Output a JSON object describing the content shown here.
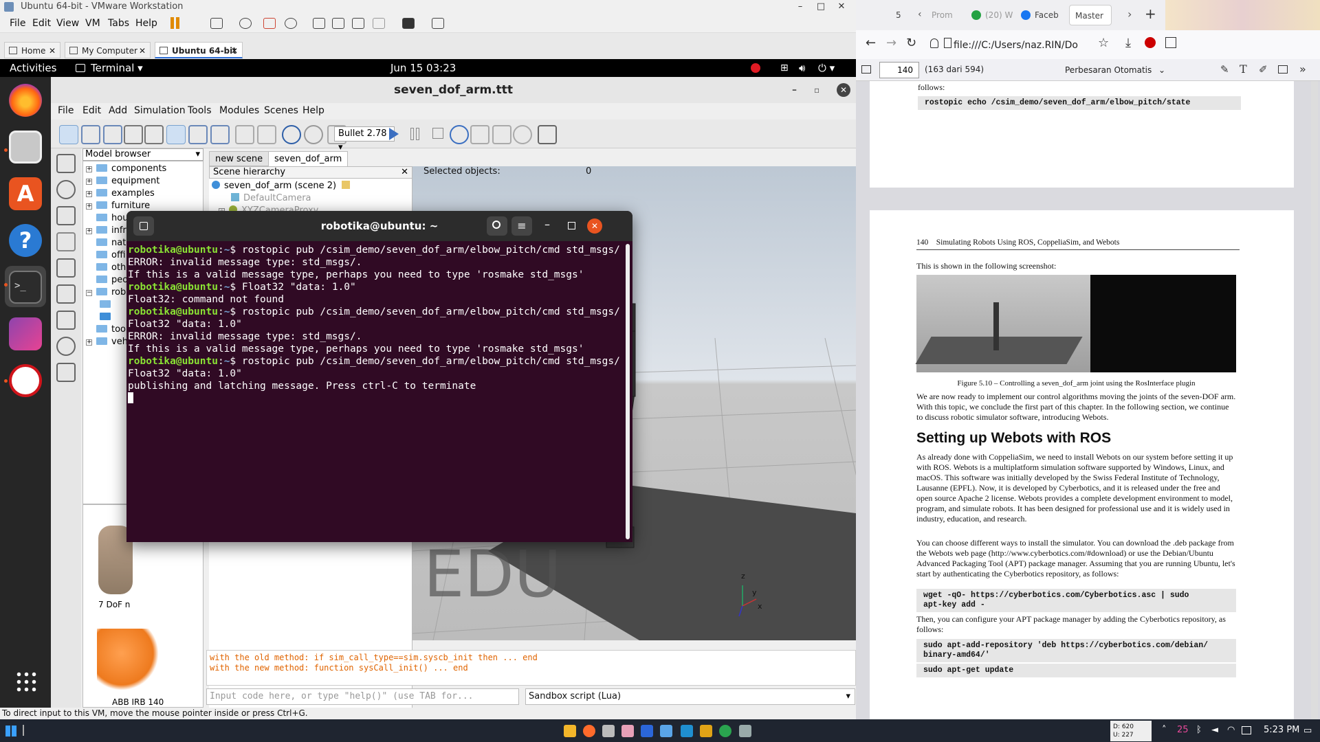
{
  "vmware": {
    "title": "Ubuntu 64-bit - VMware Workstation",
    "menu": [
      "File",
      "Edit",
      "View",
      "VM",
      "Tabs",
      "Help"
    ],
    "tabs": [
      {
        "label": "Home"
      },
      {
        "label": "My Computer"
      },
      {
        "label": "Ubuntu 64-bit"
      }
    ],
    "status_hint": "To direct input to this VM, move the mouse pointer inside or press Ctrl+G."
  },
  "ubuntu": {
    "activities": "Activities",
    "app_menu": "Terminal ▾",
    "clock": "Jun 15  03:23"
  },
  "coppelia": {
    "window_title": "seven_dof_arm.ttt",
    "menu": [
      "File",
      "Edit",
      "Add",
      "Simulation",
      "Tools",
      "Modules",
      "Scenes",
      "Help"
    ],
    "physics_engine": "Bullet 2.78",
    "model_browser": {
      "header": "Model browser",
      "items": [
        "components",
        "equipment",
        "examples",
        "furniture",
        "hou",
        "infr",
        "natu",
        "offi",
        "oth",
        "peo",
        "rob",
        "",
        "too",
        "veh"
      ],
      "thumbs": [
        {
          "label": "7 DoF n"
        },
        {
          "label": "ABB IRB 140"
        }
      ]
    },
    "scene_tabs": [
      "new scene",
      "seven_dof_arm"
    ],
    "scene_hierarchy": {
      "header": "Scene hierarchy",
      "items": [
        "seven_dof_arm (scene 2)",
        "DefaultCamera",
        "XYZCameraProxy"
      ]
    },
    "selected_objects_label": "Selected objects:",
    "selected_objects_count": "0",
    "watermark": "EDU",
    "console_lines": [
      "with the old method: if sim_call_type==sim.syscb_init then ... end",
      "with the new method: function sysCall_init() ... end"
    ],
    "input_placeholder": "Input code here, or type \"help()\" (use TAB for...",
    "script_selector": "Sandbox script (Lua)"
  },
  "terminal": {
    "title": "robotika@ubuntu: ~",
    "prompt_user": "robotika@ubuntu",
    "prompt_path": "~",
    "lines": [
      {
        "type": "cmd",
        "text": "rostopic pub /csim_demo/seven_dof_arm/elbow_pitch/cmd std_msgs/"
      },
      {
        "type": "out",
        "text": "ERROR: invalid message type: std_msgs/."
      },
      {
        "type": "out",
        "text": "If this is a valid message type, perhaps you need to type 'rosmake std_msgs'"
      },
      {
        "type": "cmd",
        "text": "Float32 \"data: 1.0\""
      },
      {
        "type": "out",
        "text": "Float32: command not found"
      },
      {
        "type": "cmd",
        "text": "rostopic pub /csim_demo/seven_dof_arm/elbow_pitch/cmd std_msgs/ Float32 \"data: 1.0\""
      },
      {
        "type": "out",
        "text": "ERROR: invalid message type: std_msgs/."
      },
      {
        "type": "out",
        "text": "If this is a valid message type, perhaps you need to type 'rosmake std_msgs'"
      },
      {
        "type": "cmd",
        "text": "rostopic pub /csim_demo/seven_dof_arm/elbow_pitch/cmd std_msgs/Float32 \"data: 1.0\""
      },
      {
        "type": "out",
        "text": "publishing and latching message. Press ctrl-C to terminate"
      }
    ]
  },
  "firefox": {
    "tabs": [
      {
        "label": "5"
      },
      {
        "label": "Prom"
      },
      {
        "label": "(20) W"
      },
      {
        "label": "Faceb"
      },
      {
        "label": "Master"
      }
    ],
    "url": "file:///C:/Users/naz.RIN/Do",
    "pdf": {
      "page_input": "140",
      "page_count": "(163 dari 594)",
      "zoom": "Perbesaran Otomatis",
      "prev_page": {
        "follows": "follows:",
        "code": "rostopic echo /csim_demo/seven_dof_arm/elbow_pitch/state"
      },
      "page": {
        "header_num": "140",
        "header_title": "Simulating Robots Using ROS, CoppeliaSim, and Webots",
        "shown": "This is shown in the following screenshot:",
        "caption": "Figure 5.10 – Controlling a seven_dof_arm joint using the RosInterface plugin",
        "para1": "We are now ready to implement our control algorithms moving the joints of the seven-DOF arm. With this topic, we conclude the first part of this chapter. In the following section, we continue to discuss robotic simulator software, introducing Webots.",
        "heading": "Setting up Webots with ROS",
        "para2": "As already done with CoppeliaSim, we need to install Webots on our system before setting it up with ROS. Webots is a multiplatform simulation software supported by Windows, Linux, and macOS. This software was initially developed by the Swiss Federal Institute of Technology, Lausanne (EPFL). Now, it is developed by Cyberbotics, and it is released under the free and open source Apache 2 license. Webots provides a complete development environment to model, program, and simulate robots. It has been designed for professional use and it is widely used in industry, education, and research.",
        "para3": "You can choose different ways to install the simulator. You can download the .deb package from the Webots web page (http://www.cyberbotics.com/#download) or use the Debian/Ubuntu Advanced Packaging Tool (APT) package manager. Assuming that you are running Ubuntu, let's start by authenticating the Cyberbotics repository, as follows:",
        "code1": "wget -qO- https://cyberbotics.com/Cyberbotics.asc | sudo\napt-key add -",
        "para4": "Then, you can configure your APT package manager by adding the Cyberbotics repository, as follows:",
        "code2": "sudo apt-add-repository 'deb https://cyberbotics.com/debian/\nbinary-amd64/'",
        "code3": "sudo apt-get update"
      }
    }
  },
  "taskbar": {
    "net_down": "D: 620",
    "net_up": "U: 227",
    "temp": "25",
    "time": "5:23 PM"
  },
  "colors": {
    "terminal_bg": "#300a24",
    "prompt_user": "#8ae234",
    "prompt_path": "#729fcf",
    "console_text": "#e06400"
  }
}
